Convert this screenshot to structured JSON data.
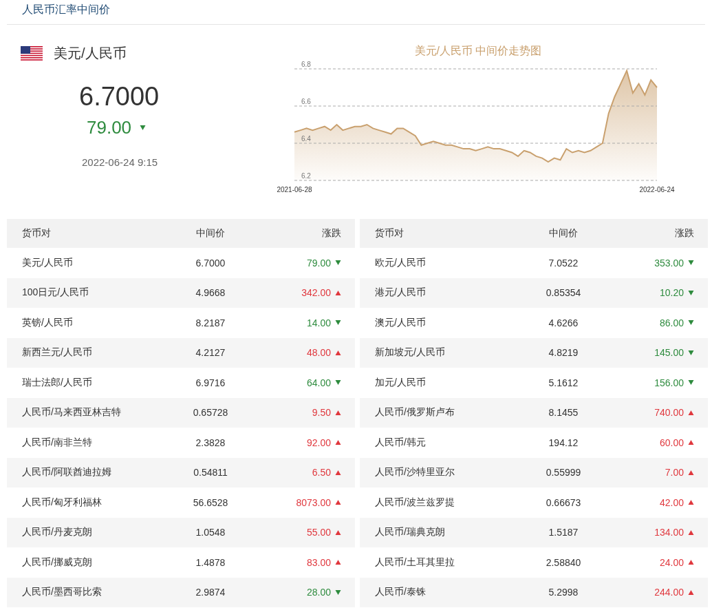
{
  "page_title": "人民币汇率中间价",
  "featured": {
    "pair": "美元/人民币",
    "rate": "6.7000",
    "change": "79.00",
    "kind": "down",
    "time": "2022-06-24 9:15"
  },
  "chart": {
    "chart_data": {
      "type": "area",
      "title": "美元/人民币 中间价走势图",
      "ylim": [
        6.2,
        6.8
      ],
      "yticks": [
        6.2,
        6.4,
        6.6,
        6.8
      ],
      "series": [
        {
          "color": "#c9a06e",
          "values": [
            6.46,
            6.47,
            6.48,
            6.47,
            6.48,
            6.49,
            6.47,
            6.5,
            6.47,
            6.48,
            6.49,
            6.49,
            6.5,
            6.48,
            6.47,
            6.46,
            6.45,
            6.48,
            6.48,
            6.46,
            6.44,
            6.39,
            6.4,
            6.41,
            6.4,
            6.39,
            6.39,
            6.38,
            6.37,
            6.37,
            6.36,
            6.37,
            6.38,
            6.37,
            6.37,
            6.36,
            6.35,
            6.33,
            6.36,
            6.35,
            6.33,
            6.32,
            6.3,
            6.32,
            6.31,
            6.37,
            6.35,
            6.36,
            6.35,
            6.36,
            6.38,
            6.4,
            6.56,
            6.65,
            6.72,
            6.79,
            6.67,
            6.72,
            6.66,
            6.74,
            6.7
          ]
        }
      ]
    },
    "axis_start": "2021-06-28",
    "axis_end": "2022-06-24"
  },
  "tables": [
    {
      "columns": [
        "货币对",
        "中间价",
        "涨跌"
      ],
      "rows": [
        {
          "pair": "美元/人民币",
          "mid": "6.7000",
          "change": "79.00",
          "kind": "down"
        },
        {
          "pair": "100日元/人民币",
          "mid": "4.9668",
          "change": "342.00",
          "kind": "up"
        },
        {
          "pair": "英镑/人民币",
          "mid": "8.2187",
          "change": "14.00",
          "kind": "down"
        },
        {
          "pair": "新西兰元/人民币",
          "mid": "4.2127",
          "change": "48.00",
          "kind": "up"
        },
        {
          "pair": "瑞士法郎/人民币",
          "mid": "6.9716",
          "change": "64.00",
          "kind": "down"
        },
        {
          "pair": "人民币/马来西亚林吉特",
          "mid": "0.65728",
          "change": "9.50",
          "kind": "up"
        },
        {
          "pair": "人民币/南非兰特",
          "mid": "2.3828",
          "change": "92.00",
          "kind": "up"
        },
        {
          "pair": "人民币/阿联酋迪拉姆",
          "mid": "0.54811",
          "change": "6.50",
          "kind": "up"
        },
        {
          "pair": "人民币/匈牙利福林",
          "mid": "56.6528",
          "change": "8073.00",
          "kind": "up"
        },
        {
          "pair": "人民币/丹麦克朗",
          "mid": "1.0548",
          "change": "55.00",
          "kind": "up"
        },
        {
          "pair": "人民币/挪威克朗",
          "mid": "1.4878",
          "change": "83.00",
          "kind": "up"
        },
        {
          "pair": "人民币/墨西哥比索",
          "mid": "2.9874",
          "change": "28.00",
          "kind": "down"
        }
      ]
    },
    {
      "columns": [
        "货币对",
        "中间价",
        "涨跌"
      ],
      "rows": [
        {
          "pair": "欧元/人民币",
          "mid": "7.0522",
          "change": "353.00",
          "kind": "down"
        },
        {
          "pair": "港元/人民币",
          "mid": "0.85354",
          "change": "10.20",
          "kind": "down"
        },
        {
          "pair": "澳元/人民币",
          "mid": "4.6266",
          "change": "86.00",
          "kind": "down"
        },
        {
          "pair": "新加坡元/人民币",
          "mid": "4.8219",
          "change": "145.00",
          "kind": "down"
        },
        {
          "pair": "加元/人民币",
          "mid": "5.1612",
          "change": "156.00",
          "kind": "down"
        },
        {
          "pair": "人民币/俄罗斯卢布",
          "mid": "8.1455",
          "change": "740.00",
          "kind": "up"
        },
        {
          "pair": "人民币/韩元",
          "mid": "194.12",
          "change": "60.00",
          "kind": "up"
        },
        {
          "pair": "人民币/沙特里亚尔",
          "mid": "0.55999",
          "change": "7.00",
          "kind": "up"
        },
        {
          "pair": "人民币/波兰兹罗提",
          "mid": "0.66673",
          "change": "42.00",
          "kind": "up"
        },
        {
          "pair": "人民币/瑞典克朗",
          "mid": "1.5187",
          "change": "134.00",
          "kind": "up"
        },
        {
          "pair": "人民币/土耳其里拉",
          "mid": "2.58840",
          "change": "24.00",
          "kind": "up"
        },
        {
          "pair": "人民币/泰铢",
          "mid": "5.2998",
          "change": "244.00",
          "kind": "up"
        }
      ]
    }
  ]
}
